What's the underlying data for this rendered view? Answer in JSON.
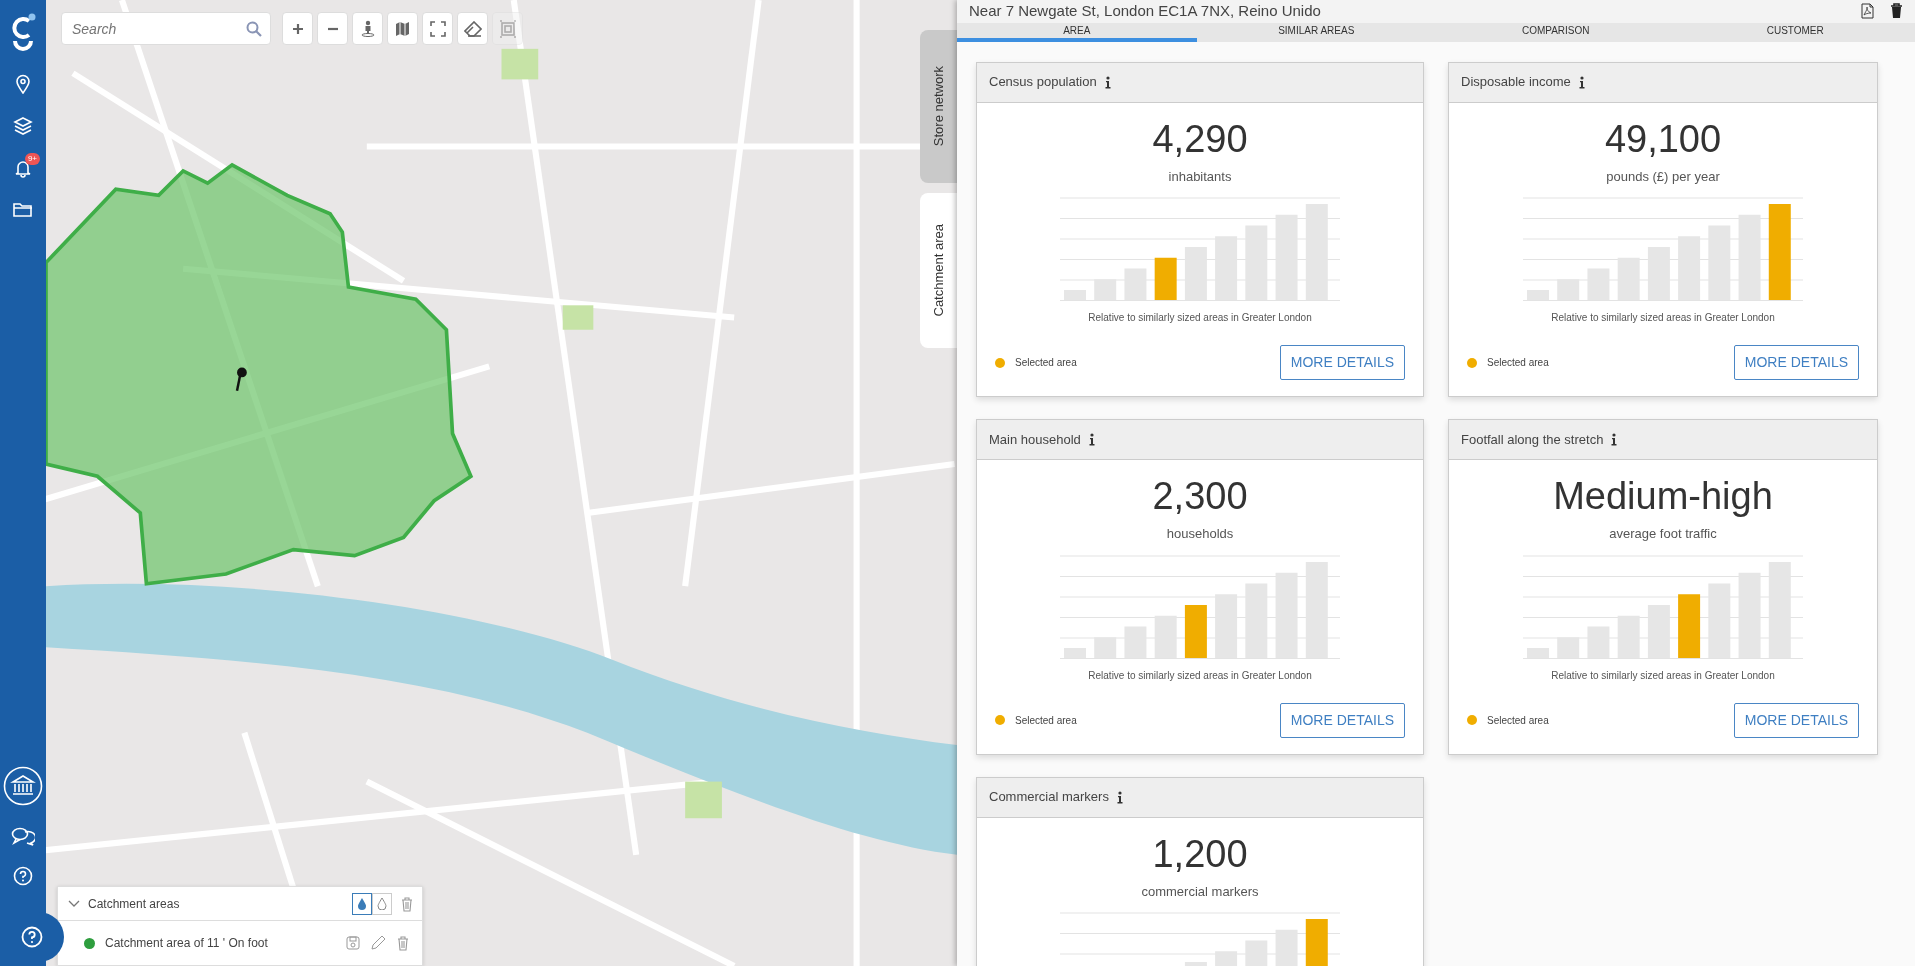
{
  "sidebar": {
    "notification_badge": "9+"
  },
  "map": {
    "search": {
      "placeholder": "Search"
    },
    "tools": [
      {
        "kind": "zoom-in",
        "disabled": false
      },
      {
        "kind": "zoom-out",
        "disabled": false
      },
      {
        "kind": "person",
        "disabled": false
      },
      {
        "kind": "map",
        "disabled": false
      },
      {
        "kind": "fullscreen",
        "disabled": false
      },
      {
        "kind": "eraser",
        "disabled": false
      },
      {
        "kind": "select",
        "disabled": true
      }
    ]
  },
  "side_tabs": [
    {
      "label": "Store network",
      "selected": false
    },
    {
      "label": "Catchment area",
      "selected": true
    }
  ],
  "catchment_panel": {
    "title": "Catchment areas",
    "expanded": true,
    "fill_modes": [
      {
        "kind": "filled",
        "selected": true
      },
      {
        "kind": "outline",
        "selected": false
      }
    ],
    "areas": [
      {
        "label": "Catchment area of 11 ' On foot",
        "color": "#2e9e3e"
      }
    ]
  },
  "panel": {
    "title": "Near 7 Newgate St, London EC1A 7NX, Reino Unido",
    "tabs": [
      {
        "label": "AREA",
        "selected": true
      },
      {
        "label": "SIMILAR AREAS",
        "selected": false
      },
      {
        "label": "COMPARISON",
        "selected": false
      },
      {
        "label": "CUSTOMER",
        "selected": false
      }
    ],
    "cards": [
      {
        "title": "Census population",
        "value": "4,290",
        "unit": "inhabitants",
        "caption": "Relative to similarly sized areas in Greater London",
        "legend": "Selected area",
        "button": "MORE DETAILS",
        "bars": [
          {
            "selected": false
          },
          {
            "selected": false
          },
          {
            "selected": false
          },
          {
            "selected": true
          },
          {
            "selected": false
          },
          {
            "selected": false
          },
          {
            "selected": false
          },
          {
            "selected": false
          },
          {
            "selected": false
          }
        ]
      },
      {
        "title": "Disposable income",
        "value": "49,100",
        "unit": "pounds (£) per year",
        "caption": "Relative to similarly sized areas in Greater London",
        "legend": "Selected area",
        "button": "MORE DETAILS",
        "bars": [
          {
            "selected": false
          },
          {
            "selected": false
          },
          {
            "selected": false
          },
          {
            "selected": false
          },
          {
            "selected": false
          },
          {
            "selected": false
          },
          {
            "selected": false
          },
          {
            "selected": false
          },
          {
            "selected": true
          }
        ]
      },
      {
        "title": "Main household",
        "value": "2,300",
        "unit": "households",
        "caption": "Relative to similarly sized areas in Greater London",
        "legend": "Selected area",
        "button": "MORE DETAILS",
        "bars": [
          {
            "selected": false
          },
          {
            "selected": false
          },
          {
            "selected": false
          },
          {
            "selected": false
          },
          {
            "selected": true
          },
          {
            "selected": false
          },
          {
            "selected": false
          },
          {
            "selected": false
          },
          {
            "selected": false
          }
        ]
      },
      {
        "title": "Footfall along the stretch",
        "value": "Medium-high",
        "unit": "average foot traffic",
        "caption": "Relative to similarly sized areas in Greater London",
        "legend": "Selected area",
        "button": "MORE DETAILS",
        "bars": [
          {
            "selected": false
          },
          {
            "selected": false
          },
          {
            "selected": false
          },
          {
            "selected": false
          },
          {
            "selected": false
          },
          {
            "selected": true
          },
          {
            "selected": false
          },
          {
            "selected": false
          },
          {
            "selected": false
          }
        ]
      },
      {
        "title": "Commercial markers",
        "value": "1,200",
        "unit": "commercial markers",
        "bars": [
          {
            "selected": false
          },
          {
            "selected": false
          },
          {
            "selected": false
          },
          {
            "selected": false
          },
          {
            "selected": true
          }
        ]
      }
    ]
  }
}
